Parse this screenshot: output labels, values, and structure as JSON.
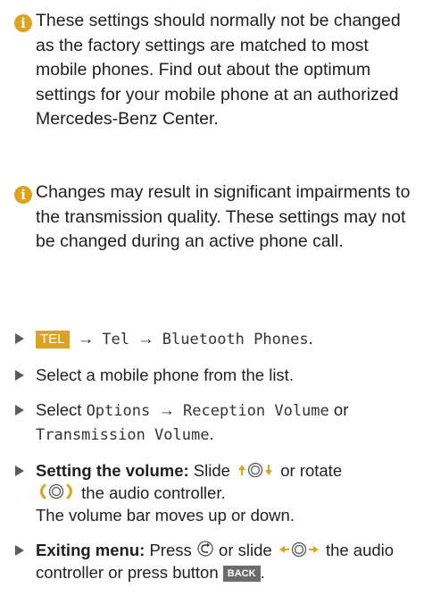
{
  "notes": [
    {
      "icon": "info-icon",
      "text": "These settings should normally not be changed as the factory settings are matched to most mobile phones. Find out about the optimum settings for your mobile phone at an authorized Mercedes-Benz Center."
    },
    {
      "icon": "info-icon",
      "text": "Changes may result in significant impairments to the transmission quality. These settings may not be changed during an active phone call."
    }
  ],
  "steps": {
    "step1": {
      "key": "TEL",
      "menu1": "Tel",
      "menu2": "Bluetooth Phones",
      "end": "."
    },
    "step2": {
      "text": "Select a mobile phone from the list."
    },
    "step3": {
      "pre": "Select",
      "menu1": "Options",
      "menu2": "Reception Volume",
      "or": "or",
      "menu3": "Transmission Volume",
      "end": "."
    },
    "step4": {
      "bold": "Setting the volume:",
      "pre": "Slide",
      "mid": "or rotate",
      "post": "the audio controller.",
      "result": "The volume bar moves up or down."
    },
    "step5": {
      "bold": "Exiting menu:",
      "pre": "Press",
      "mid": "or slide",
      "post": "the audio controller or press button",
      "key": "BACK",
      "end": "."
    }
  },
  "colors": {
    "accent": "#dca31d",
    "text": "#1f1f1f",
    "key_dark": "#6b6b6b"
  }
}
